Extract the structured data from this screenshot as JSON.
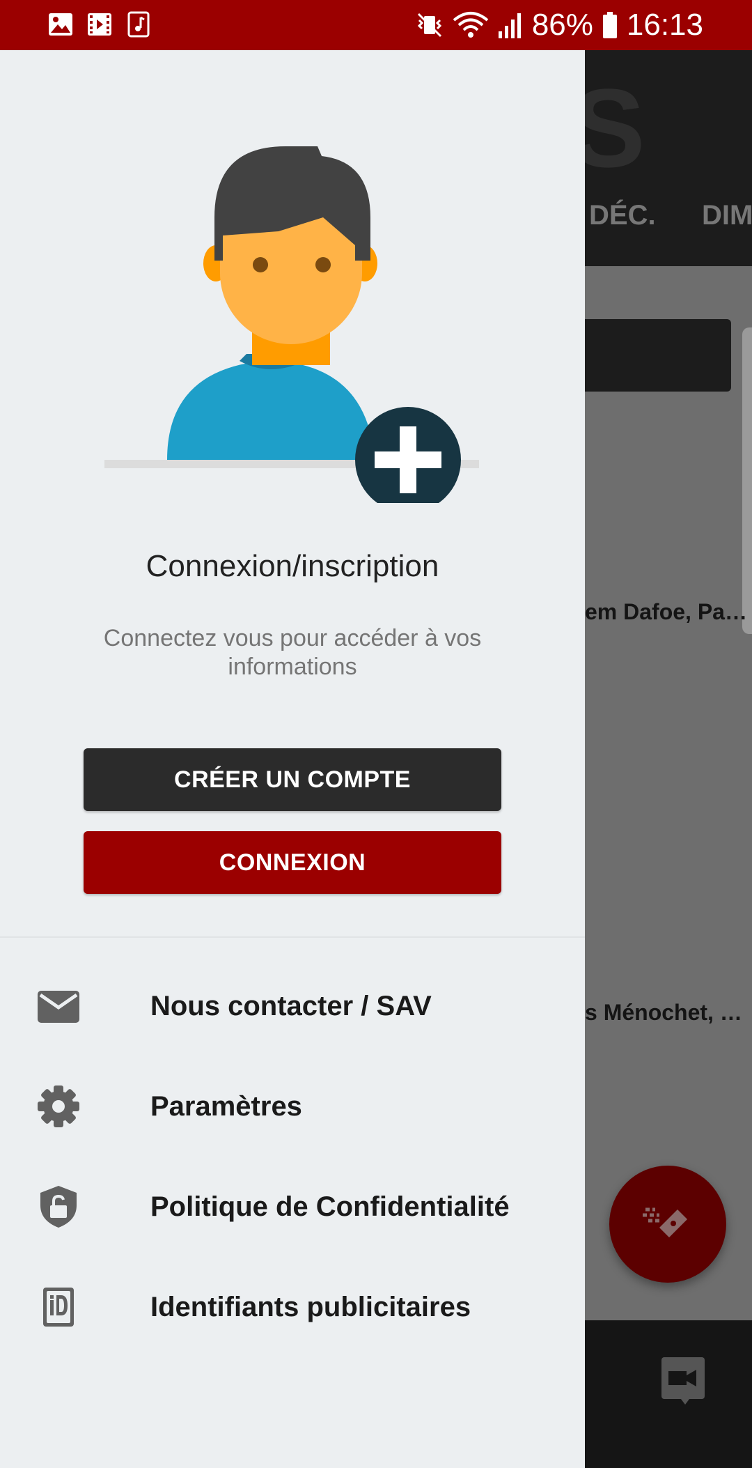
{
  "status_bar": {
    "battery": "86%",
    "time": "16:13"
  },
  "drawer": {
    "title": "Connexion/inscription",
    "subtitle": "Connectez vous pour accéder à vos informations",
    "create_account_label": "CRÉER UN COMPTE",
    "login_label": "CONNEXION",
    "menu": [
      {
        "label": "Nous contacter / SAV",
        "icon": "mail-icon"
      },
      {
        "label": "Paramètres",
        "icon": "gear-icon"
      },
      {
        "label": "Politique de Confidentialité",
        "icon": "shield-lock-icon"
      },
      {
        "label": "Identifiants publicitaires",
        "icon": "id-card-icon"
      }
    ]
  },
  "background_app": {
    "tab_1": "DÉC.",
    "tab_2": "DIM",
    "cast_line_1": "em Dafoe, Pa…",
    "cast_line_2": "s Ménochet, …"
  },
  "colors": {
    "brand_red": "#9b0000",
    "dark_button": "#2b2b2b",
    "drawer_bg": "#eceff1"
  }
}
